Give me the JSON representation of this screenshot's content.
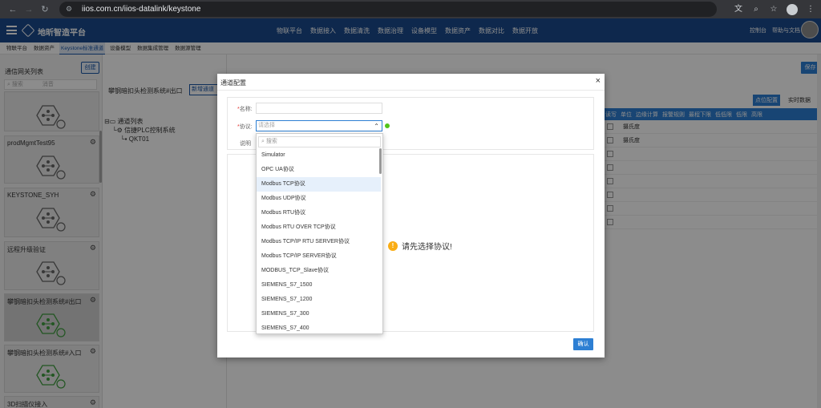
{
  "browser": {
    "url": "iios.com.cn/iios-datalink/keystone"
  },
  "app": {
    "name": "地昕智造平台",
    "nav": [
      "物联平台",
      "数据接入",
      "数据清洗",
      "数据治理",
      "设备模型",
      "数据资产",
      "数据对比",
      "数据开放"
    ],
    "right_links": [
      "控制台",
      "帮助与文档"
    ]
  },
  "subnav": {
    "tabs": [
      "物联平台",
      "数据资产",
      "Keystone标准通道",
      "设备模型",
      "数据集成管理",
      "数据源管理"
    ],
    "active": 2
  },
  "left": {
    "title": "通信网关列表",
    "create": "创建",
    "search_placeholder": "搜索",
    "search_suffix": "消音",
    "cards": [
      "prodMgmtTest95",
      "KEYSTONE_SYH",
      "远程升级验证",
      "攀钢暗扣头检测系统#出口",
      "攀钢暗扣头检测系统#入口",
      "3D扫描仪接入"
    ]
  },
  "middle": {
    "title": "攀钢暗扣头检测系统#出口",
    "new_channel": "新增通道",
    "tree": {
      "root": "通道列表",
      "child": "信捷PLC控制系统",
      "leaf": "QKT01"
    }
  },
  "right": {
    "save": "保存",
    "point_config": "点位配置",
    "realtime": "实时数据",
    "columns": [
      "读写",
      "单位",
      "边缘计算",
      "报警规则",
      "最程下限",
      "低低限",
      "低限",
      "高限"
    ],
    "rows": [
      {
        "unit": "摄氏度"
      },
      {
        "unit": "摄氏度"
      },
      {
        "unit": ""
      },
      {
        "unit": ""
      },
      {
        "unit": ""
      },
      {
        "unit": ""
      },
      {
        "unit": ""
      },
      {
        "unit": ""
      }
    ]
  },
  "modal": {
    "title": "通道配置",
    "name_label": "名称:",
    "protocol_label": "协议:",
    "protocol_placeholder": "请选择",
    "desc_label": "说明",
    "hint": "请先选择协议!",
    "confirm": "确认",
    "dropdown": {
      "search_placeholder": "搜索",
      "options": [
        "Simulator",
        "OPC UA协议",
        "Modbus TCP协议",
        "Modbus UDP协议",
        "Modbus RTU协议",
        "Modbus RTU OVER TCP协议",
        "Modbus TCP/IP RTU SERVER协议",
        "Modbus TCP/IP SERVER协议",
        "MODBUS_TCP_Slave协议",
        "SIEMENS_S7_1500",
        "SIEMENS_S7_1200",
        "SIEMENS_S7_300",
        "SIEMENS_S7_400"
      ],
      "highlighted": 2
    }
  },
  "colors": {
    "brand": "#1a4a8d",
    "primary": "#2d7fd3",
    "selected_gateway": "#3f9d3f"
  }
}
